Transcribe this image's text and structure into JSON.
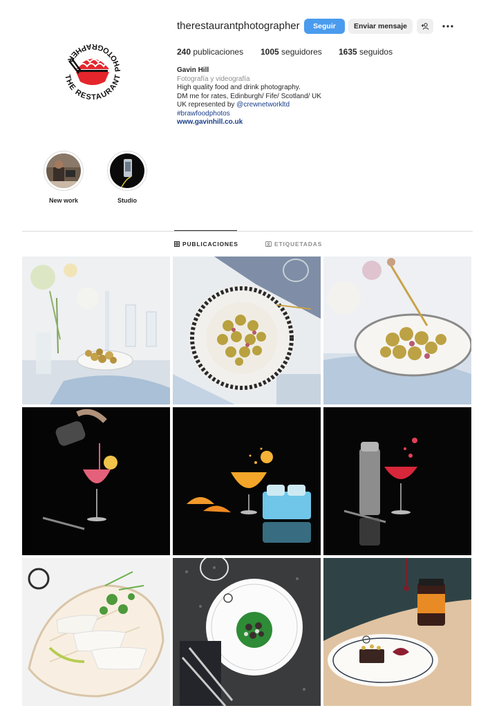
{
  "profile": {
    "username": "therestaurantphotographer",
    "logo_text": "THE RESTAURANT PHOTOGRAPHER"
  },
  "actions": {
    "follow_label": "Seguir",
    "message_label": "Enviar mensaje",
    "add_person_icon": "add-person-icon",
    "more_icon": "more-icon"
  },
  "stats": {
    "posts_count": "240",
    "posts_label": "publicaciones",
    "followers_count": "1005",
    "followers_label": "seguidores",
    "following_count": "1635",
    "following_label": "seguidos"
  },
  "bio": {
    "name": "Gavin Hill",
    "category": "Fotografía y videografía",
    "line1": "High quality food and drink photography.",
    "line2": "DM me for rates, Edinburgh/ Fife/ Scotland/ UK",
    "line3_prefix": "UK represented by ",
    "mention": "@crewnetworkltd",
    "hashtag": "#brawfoodphotos",
    "website": "www.gavinhill.co.uk"
  },
  "highlights": [
    {
      "label": "New work"
    },
    {
      "label": "Studio"
    }
  ],
  "tabs": {
    "posts": "PUBLICACIONES",
    "tagged": "ETIQUETADAS"
  },
  "colors": {
    "accent": "#4a9bee",
    "logo_red": "#e4262c",
    "link": "#1a3f8a"
  },
  "posts": [
    {
      "subject": "potatoes-table-setting"
    },
    {
      "subject": "potatoes-plate-overhead"
    },
    {
      "subject": "potatoes-fork"
    },
    {
      "subject": "cocktail-pour"
    },
    {
      "subject": "orange-cocktail-splash"
    },
    {
      "subject": "red-cocktail-shaker"
    },
    {
      "subject": "scallop-dish"
    },
    {
      "subject": "green-dish-overhead"
    },
    {
      "subject": "chocolate-dessert"
    }
  ]
}
